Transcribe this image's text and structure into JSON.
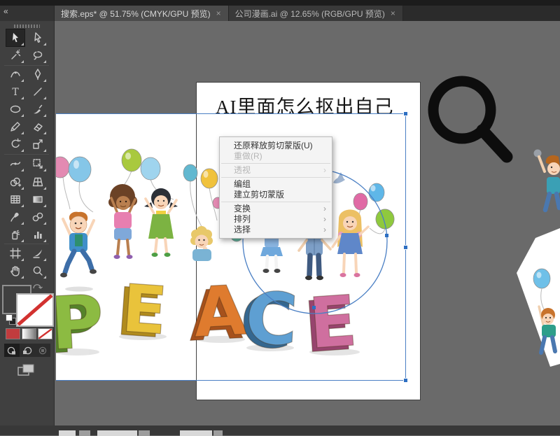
{
  "window": {
    "collapse_chevron": "«",
    "tabs": [
      {
        "title": "搜索.eps* @ 51.75% (CMYK/GPU 预览)",
        "close": "×",
        "active": true
      },
      {
        "title": "公司漫画.ai @ 12.65% (RGB/GPU 预览)",
        "close": "×",
        "active": false
      }
    ]
  },
  "toolbar": {
    "tools": [
      "selection",
      "direct-selection",
      "magic-wand",
      "lasso",
      "curvature",
      "pen",
      "type",
      "line-segment",
      "ellipse",
      "paintbrush",
      "pencil",
      "eraser",
      "rotate",
      "scale",
      "width",
      "free-transform",
      "shape-builder",
      "perspective-grid",
      "mesh",
      "gradient",
      "eyedropper",
      "blend",
      "symbol-sprayer",
      "column-graph",
      "artboard",
      "slice",
      "hand",
      "zoom"
    ],
    "selected_tool": "selection"
  },
  "artboard": {
    "heading": "AI里面怎么抠出自己"
  },
  "context_menu": {
    "submenu_arrow": "›",
    "items": [
      {
        "label": "还原释放剪切蒙版(U)",
        "enabled": true,
        "submenu": false
      },
      {
        "label": "重做(R)",
        "enabled": false,
        "submenu": false
      },
      {
        "label": "透视",
        "enabled": false,
        "submenu": true
      },
      {
        "label": "编组",
        "enabled": true,
        "submenu": false
      },
      {
        "label": "建立剪切蒙版",
        "enabled": true,
        "submenu": false
      },
      {
        "label": "变换",
        "enabled": true,
        "submenu": true
      },
      {
        "label": "排列",
        "enabled": true,
        "submenu": true
      },
      {
        "label": "选择",
        "enabled": true,
        "submenu": true
      }
    ]
  },
  "artwork": {
    "word": "PEACE",
    "letters": [
      {
        "char": "P",
        "color": "#8cbb42",
        "side": "#55832a"
      },
      {
        "char": "E",
        "color": "#e9c33b",
        "side": "#b08b1e"
      },
      {
        "char": "A",
        "color": "#df7b2e",
        "side": "#a6511c"
      },
      {
        "char": "C",
        "color": "#5e9fd2",
        "side": "#35678f"
      },
      {
        "char": "E",
        "color": "#cf6f9f",
        "side": "#97446e"
      }
    ],
    "balloon_colors": [
      "#e38ab2",
      "#85c6e8",
      "#a9c93e",
      "#f0c23c",
      "#62b8a0"
    ]
  },
  "colors": {
    "pasteboard": "#6a6a6a",
    "selection_blue": "#4a7fc4",
    "magnifier": "#0d0d0d",
    "stroke_none_red": "#d23230"
  }
}
